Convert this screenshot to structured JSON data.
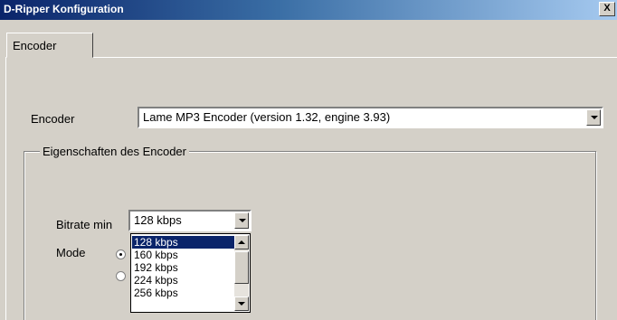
{
  "window": {
    "title": "D-Ripper Konfiguration",
    "close_label": "X"
  },
  "tabs": [
    {
      "label": "Encoder",
      "active": true
    }
  ],
  "encoder": {
    "label": "Encoder",
    "selected": "Lame MP3 Encoder (version 1.32, engine 3.93)"
  },
  "group": {
    "title": "Eigenschaften des Encoder"
  },
  "bitrate_min": {
    "label": "Bitrate min",
    "selected": "128 kbps"
  },
  "mode": {
    "label": "Mode"
  },
  "bitrate_options": [
    {
      "label": "128 kbps",
      "selected": true
    },
    {
      "label": "160 kbps",
      "selected": false
    },
    {
      "label": "192 kbps",
      "selected": false
    },
    {
      "label": "224 kbps",
      "selected": false
    },
    {
      "label": "256 kbps",
      "selected": false
    }
  ],
  "colors": {
    "title_bar": "#0a246a",
    "dialog_bg": "#d4d0c8",
    "selection": "#0a246a"
  }
}
